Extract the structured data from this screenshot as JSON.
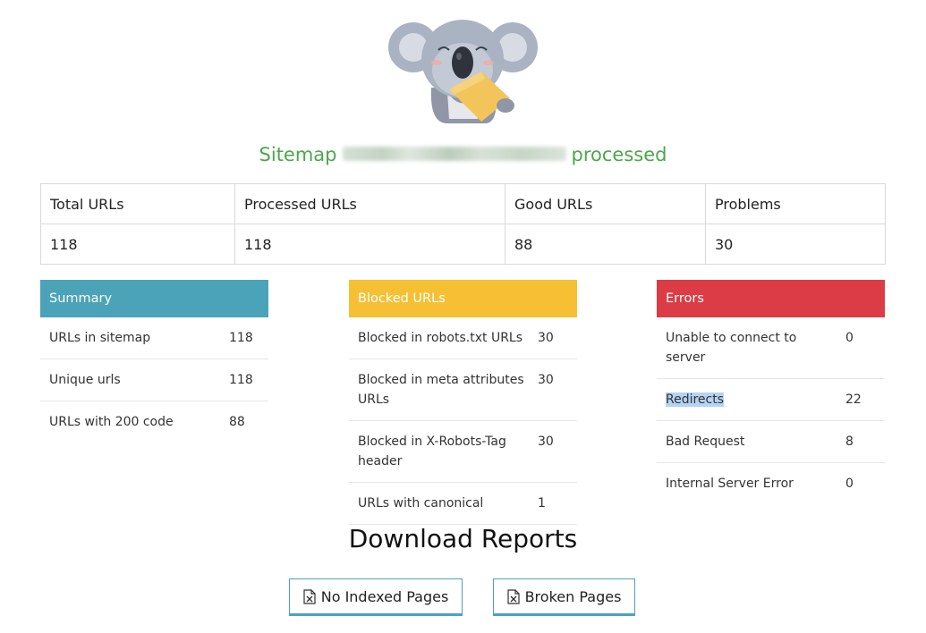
{
  "headline": {
    "prefix": "Sitemap",
    "suffix": "processed"
  },
  "stats": {
    "headers": [
      "Total URLs",
      "Processed URLs",
      "Good URLs",
      "Problems"
    ],
    "values": [
      "118",
      "118",
      "88",
      "30"
    ]
  },
  "summary": {
    "title": "Summary",
    "color": "#4aa3b8",
    "rows": [
      {
        "label": "URLs in sitemap",
        "value": "118"
      },
      {
        "label": "Unique urls",
        "value": "118"
      },
      {
        "label": "URLs with 200 code",
        "value": "88"
      }
    ]
  },
  "blocked": {
    "title": "Blocked URLs",
    "color": "#f5c033",
    "rows": [
      {
        "label": "Blocked in robots.txt URLs",
        "value": "30"
      },
      {
        "label": "Blocked in meta attributes URLs",
        "value": "30"
      },
      {
        "label": "Blocked in X-Robots-Tag header",
        "value": "30"
      },
      {
        "label": "URLs with canonical",
        "value": "1"
      }
    ]
  },
  "errors": {
    "title": "Errors",
    "color": "#dc3c46",
    "rows": [
      {
        "label": "Unable to connect to server",
        "value": "0"
      },
      {
        "label": "Redirects",
        "value": "22"
      },
      {
        "label": "Bad Request",
        "value": "8"
      },
      {
        "label": "Internal Server Error",
        "value": "0"
      }
    ]
  },
  "download": {
    "title": "Download Reports",
    "buttons": [
      {
        "label": "No Indexed Pages",
        "icon": "excel-file-icon"
      },
      {
        "label": "Broken Pages",
        "icon": "excel-file-icon"
      }
    ]
  }
}
